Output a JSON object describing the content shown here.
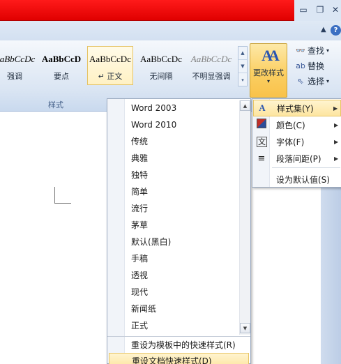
{
  "window": {
    "minimize_glyph": "▭",
    "restore_glyph": "❐",
    "close_glyph": "✕",
    "ribbon_collapse_glyph": "▲",
    "help_glyph": "?"
  },
  "ribbon": {
    "styles_group_label": "样式",
    "style_gallery": [
      {
        "sample": "AaBbCcDc",
        "name": "强调"
      },
      {
        "sample": "AaBbCcD",
        "name": "要点"
      },
      {
        "sample": "AaBbCcDc",
        "name": "↵ 正文"
      },
      {
        "sample": "AaBbCcDc",
        "name": "无间隔"
      },
      {
        "sample": "AaBbCcDc",
        "name": "不明显强调"
      }
    ],
    "change_styles": {
      "icon": "AA",
      "label": "更改样式",
      "dropdown": "▾"
    },
    "editing": [
      {
        "icon": "👓",
        "label": "查找",
        "arrow": "▾"
      },
      {
        "icon": "ab",
        "label": "替换",
        "arrow": ""
      },
      {
        "icon": "⇖",
        "label": "选择",
        "arrow": "▾"
      }
    ],
    "gallery_scroll": [
      "▲",
      "▼",
      "▾"
    ]
  },
  "style_set_menu": {
    "items": [
      "Word 2003",
      "Word 2010",
      "传统",
      "典雅",
      "独特",
      "简单",
      "流行",
      "茅草",
      "默认(黑白)",
      "手稿",
      "透视",
      "现代",
      "新闻纸",
      "正式"
    ],
    "footer": [
      "重设为模板中的快速样式(R)",
      "重设文档快速样式(D)"
    ],
    "scroll_up": "▲",
    "scroll_down": "▼"
  },
  "change_styles_menu": {
    "items": [
      {
        "icon": "A",
        "label": "样式集(Y)",
        "submenu": "▶"
      },
      {
        "icon": "",
        "label": "颜色(C)",
        "submenu": "▶"
      },
      {
        "icon": "文",
        "label": "字体(F)",
        "submenu": "▶"
      },
      {
        "icon": "≡",
        "label": "段落间距(P)",
        "submenu": "▶"
      },
      {
        "icon": "",
        "label": "设为默认值(S)",
        "submenu": ""
      }
    ]
  },
  "colors": {
    "title_red": "#e00000",
    "hover_gold": "#fde5a0",
    "ribbon_blue": "#dae5f3"
  }
}
